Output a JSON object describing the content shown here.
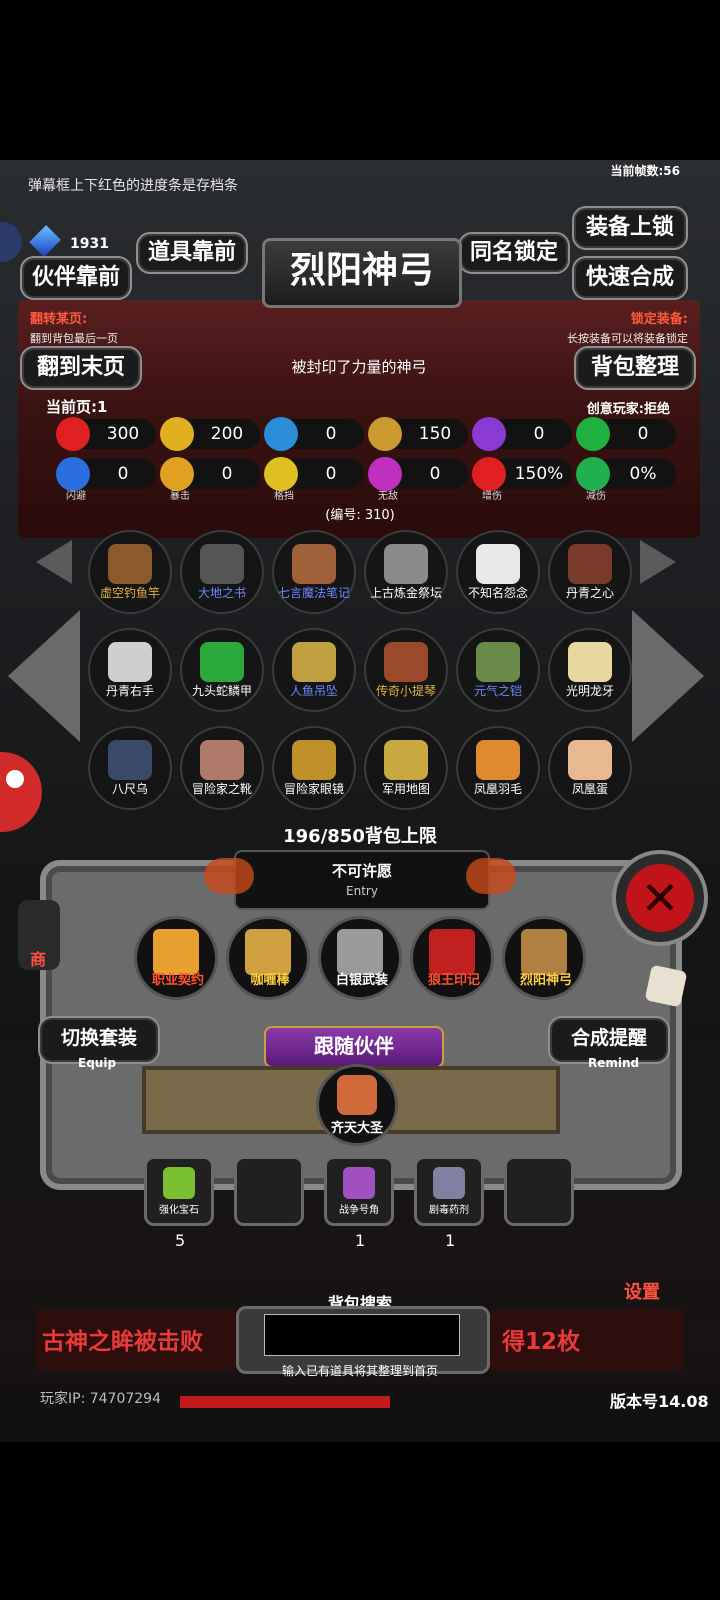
{
  "hint_text": "弹幕框上下红色的进度条是存档条",
  "fps_text": "当前帧数:56",
  "partial_currency": "1931",
  "buttons": {
    "lock_equip": "装备上锁",
    "items_front": "道具靠前",
    "same_name_lock": "同名锁定",
    "partner_front": "伙伴靠前",
    "quick_combine": "快速合成",
    "to_last_page": "翻到末页",
    "sort_bag": "背包整理",
    "switch_set": "切换套装",
    "switch_set_sub": "Equip",
    "combine_remind": "合成提醒",
    "combine_remind_sub": "Remind",
    "settings": "设置",
    "shop_partial": "商"
  },
  "title": "烈阳神弓",
  "page_turn_label": "翻转某页:",
  "page_turn_desc": "翻到背包最后一页",
  "lock_label": "锁定装备:",
  "lock_desc": "长按装备可以将装备锁定",
  "description": "被封印了力量的神弓",
  "current_page": "当前页:1",
  "creative_player": "创意玩家:拒绝",
  "stats_row1": [
    {
      "icon": "heart-icon",
      "value": "300",
      "color": "#e02020"
    },
    {
      "icon": "strength-icon",
      "value": "200",
      "color": "#e0b020"
    },
    {
      "icon": "helmet-icon",
      "value": "0",
      "color": "#2a8ed8"
    },
    {
      "icon": "sword-icon",
      "value": "150",
      "color": "#c89a30"
    },
    {
      "icon": "lightning-icon",
      "value": "0",
      "color": "#8a3ad0"
    },
    {
      "icon": "clover-icon",
      "value": "0",
      "color": "#20b040"
    }
  ],
  "stats_row2": [
    {
      "icon": "dodge-icon",
      "value": "0",
      "label": "闪避",
      "color": "#2a6ee0"
    },
    {
      "icon": "critical-icon",
      "value": "0",
      "label": "暴击",
      "color": "#e0a020"
    },
    {
      "icon": "block-shield-icon",
      "value": "0",
      "label": "格挡",
      "color": "#e0c020"
    },
    {
      "icon": "invincible-wings-icon",
      "value": "0",
      "label": "无敌",
      "color": "#c030c0"
    },
    {
      "icon": "damage-boost-icon",
      "value": "150%",
      "label": "增伤",
      "color": "#e02020"
    },
    {
      "icon": "damage-reduce-icon",
      "value": "0%",
      "label": "减伤",
      "color": "#20b050"
    }
  ],
  "item_number": "(编号: 310)",
  "items": [
    {
      "name": "虚空钓鱼竿",
      "color": "#e0b040",
      "pic": "#8a5a2a"
    },
    {
      "name": "大地之书",
      "color": "#6a8aff",
      "pic": "#555555"
    },
    {
      "name": "七言魔法笔记",
      "color": "#6a8aff",
      "pic": "#a0603a"
    },
    {
      "name": "上古炼金祭坛",
      "color": "#ffffff",
      "pic": "#8a8a8a"
    },
    {
      "name": "不知名怨念",
      "color": "#ffffff",
      "pic": "#e8e8e8"
    },
    {
      "name": "丹青之心",
      "color": "#ffffff",
      "pic": "#7a3a2a"
    },
    {
      "name": "丹青右手",
      "color": "#ffffff",
      "pic": "#cfcfcf"
    },
    {
      "name": "九头蛇鳞甲",
      "color": "#ffffff",
      "pic": "#2aa83a"
    },
    {
      "name": "人鱼吊坠",
      "color": "#6a8aff",
      "pic": "#c0a040"
    },
    {
      "name": "传奇小提琴",
      "color": "#e0b040",
      "pic": "#9a4a2a"
    },
    {
      "name": "元气之铠",
      "color": "#6a8aff",
      "pic": "#6a8a4a"
    },
    {
      "name": "光明龙牙",
      "color": "#ffffff",
      "pic": "#e8d8a0"
    },
    {
      "name": "八尺乌",
      "color": "#ffffff",
      "pic": "#3a4a6a"
    },
    {
      "name": "冒险家之靴",
      "color": "#ffffff",
      "pic": "#b07a6a"
    },
    {
      "name": "冒险家眼镜",
      "color": "#ffffff",
      "pic": "#c0902a"
    },
    {
      "name": "军用地图",
      "color": "#ffffff",
      "pic": "#c8a840"
    },
    {
      "name": "凤凰羽毛",
      "color": "#ffffff",
      "pic": "#e08a30"
    },
    {
      "name": "凤凰蛋",
      "color": "#ffffff",
      "pic": "#e8b890"
    }
  ],
  "bag_limit": "196/850背包上限",
  "entry_name": "不可许愿",
  "entry_label": "Entry",
  "equipped": [
    {
      "name": "职业契约",
      "color": "#ff5030",
      "pic": "#e8a030"
    },
    {
      "name": "咖喱棒",
      "color": "#ffd040",
      "pic": "#d0a040"
    },
    {
      "name": "白银武装",
      "color": "#ffffff",
      "pic": "#9a9a9a"
    },
    {
      "name": "狼王印记",
      "color": "#ff5030",
      "pic": "#c02020"
    },
    {
      "name": "烈阳神弓",
      "color": "#ffd040",
      "pic": "#b08040"
    }
  ],
  "follow_partner_label": "跟随伙伴",
  "partner_name": "齐天大圣",
  "bag_slots": [
    {
      "name": "强化宝石",
      "count": "5",
      "pic": "#7ac030"
    },
    {
      "name": "",
      "count": "",
      "pic": ""
    },
    {
      "name": "战争号角",
      "count": "1",
      "pic": "#a050c0"
    },
    {
      "name": "剧毒药剂",
      "count": "1",
      "pic": "#8080a0"
    },
    {
      "name": "",
      "count": "",
      "pic": ""
    }
  ],
  "bag_search_label": "背包搜索",
  "bag_search_hint": "输入已有道具将其整理到首页",
  "ticker_left": "古神之眸被击败",
  "ticker_right": "得12枚",
  "player_ip": "玩家IP: 74707294",
  "version": "版本号14.08"
}
